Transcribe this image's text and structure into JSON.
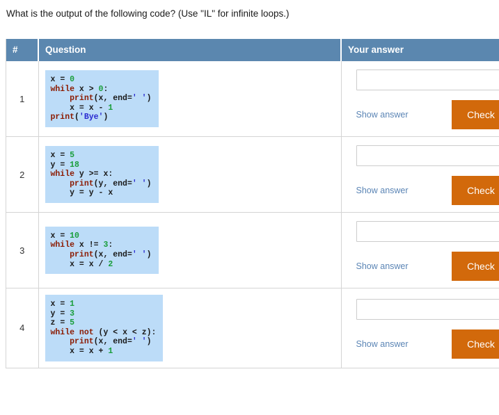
{
  "prompt": "What is the output of the following code? (Use \"IL\" for infinite loops.)",
  "colors": {
    "header_bg": "#5b87af",
    "code_bg": "#bcdcf8",
    "check_button_bg": "#d2690b",
    "link": "#5b85b5",
    "border": "#d4d4d4"
  },
  "table": {
    "headers": {
      "number": "#",
      "question": "Question",
      "answer": "Your answer"
    },
    "rows": [
      {
        "number": "1",
        "code": "x = 0\nwhile x > 0:\n    print(x, end=' ')\n    x = x - 1\nprint('Bye')",
        "answer_value": "",
        "answer_placeholder": "",
        "show_answer_label": "Show answer",
        "check_label": "Check"
      },
      {
        "number": "2",
        "code": "x = 5\ny = 18\nwhile y >= x:\n    print(y, end=' ')\n    y = y - x",
        "answer_value": "",
        "answer_placeholder": "",
        "show_answer_label": "Show answer",
        "check_label": "Check"
      },
      {
        "number": "3",
        "code": "x = 10\nwhile x != 3:\n    print(x, end=' ')\n    x = x / 2",
        "answer_value": "",
        "answer_placeholder": "",
        "show_answer_label": "Show answer",
        "check_label": "Check"
      },
      {
        "number": "4",
        "code": "x = 1\ny = 3\nz = 5\nwhile not (y < x < z):\n    print(x, end=' ')\n    x = x + 1",
        "answer_value": "",
        "answer_placeholder": "",
        "show_answer_label": "Show answer",
        "check_label": "Check"
      }
    ]
  }
}
